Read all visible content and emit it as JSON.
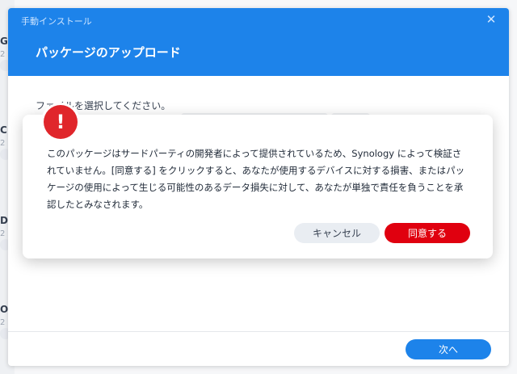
{
  "background": {
    "list_letters": [
      "G",
      "C",
      "D",
      "O"
    ],
    "list_subtext": "2"
  },
  "window": {
    "title": "手動インストール",
    "close_icon": "close-icon",
    "subtitle": "パッケージのアップロード",
    "file_label": "ファイルを選択してください。",
    "next_button": "次へ"
  },
  "dialog": {
    "icon": "!",
    "message": "このパッケージはサードパーティの開発者によって提供されているため、Synology によって検証さ\nれていません。[同意する] をクリックすると、あなたが使用するデバイスに対する損害、またはパッ\nケージの使用によって生じる可能性のあるデータ損失に対して、あなたが単独で責任を負うことを承\n認したとみなされます。",
    "cancel_button": "キャンセル",
    "agree_button": "同意する"
  },
  "colors": {
    "header_blue": "#1d83ea",
    "danger_red": "#e0000f",
    "icon_red": "#e0262b"
  }
}
